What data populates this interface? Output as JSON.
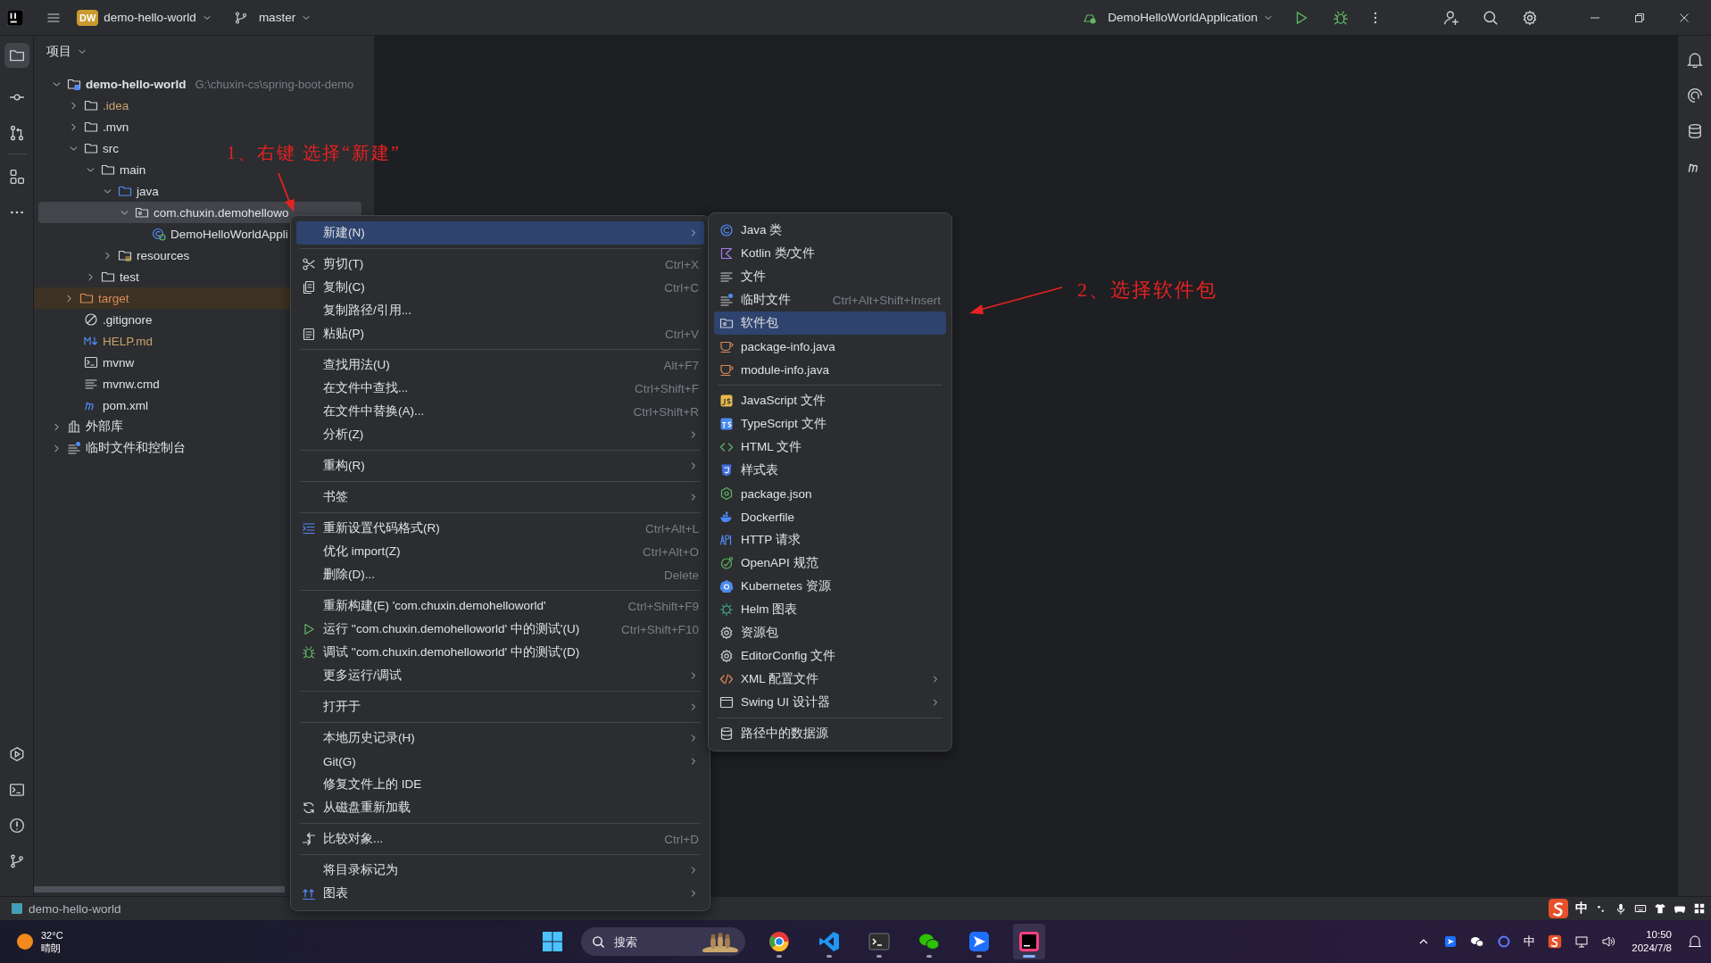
{
  "title_bar": {
    "project_badge": "DW",
    "project": "demo-hello-world",
    "branch": "master",
    "run_configuration": "DemoHelloWorldApplication"
  },
  "project_panel": {
    "title": "项目",
    "tree": [
      {
        "label": "demo-hello-world",
        "path": "G:\\chuxin-cs\\spring-boot-demo",
        "kind": "module",
        "expanded": true,
        "selected": false,
        "ignored": false,
        "children": [
          {
            "label": ".idea",
            "kind": "folder",
            "expanded": false,
            "selected": false,
            "ignored": true
          },
          {
            "label": ".mvn",
            "kind": "folder",
            "expanded": false,
            "selected": false,
            "ignored": false
          },
          {
            "label": "src",
            "kind": "folder",
            "expanded": true,
            "selected": false,
            "ignored": false,
            "children": [
              {
                "label": "main",
                "kind": "folder",
                "expanded": true,
                "selected": false,
                "ignored": false,
                "children": [
                  {
                    "label": "java",
                    "kind": "source-folder",
                    "expanded": true,
                    "selected": false,
                    "ignored": false,
                    "children": [
                      {
                        "label": "com.chuxin.demohellowo",
                        "kind": "package",
                        "expanded": true,
                        "selected": true,
                        "ignored": false,
                        "children": [
                          {
                            "label": "DemoHelloWorldAppli",
                            "kind": "class",
                            "selected": false,
                            "ignored": false
                          }
                        ]
                      }
                    ]
                  },
                  {
                    "label": "resources",
                    "kind": "resources-folder",
                    "expanded": false,
                    "selected": false,
                    "ignored": false
                  }
                ]
              },
              {
                "label": "test",
                "kind": "folder",
                "expanded": false,
                "selected": false,
                "ignored": false
              }
            ]
          },
          {
            "label": "target",
            "kind": "excluded-folder",
            "expanded": false,
            "selected": false,
            "ignored": false
          },
          {
            "label": ".gitignore",
            "kind": "ignore-file",
            "selected": false,
            "ignored": false
          },
          {
            "label": "HELP.md",
            "kind": "markdown",
            "selected": false,
            "ignored": true
          },
          {
            "label": "mvnw",
            "kind": "script",
            "selected": false,
            "ignored": false
          },
          {
            "label": "mvnw.cmd",
            "kind": "text-file",
            "selected": false,
            "ignored": false
          },
          {
            "label": "pom.xml",
            "kind": "maven",
            "selected": false,
            "ignored": false
          }
        ]
      },
      {
        "label": "外部库",
        "kind": "library",
        "expanded": false,
        "selected": false,
        "ignored": false
      },
      {
        "label": "临时文件和控制台",
        "kind": "scratch",
        "expanded": false,
        "selected": false,
        "ignored": false
      }
    ]
  },
  "context_menu": {
    "groups": [
      [
        {
          "label": "新建(N)",
          "kind": "plain",
          "submenu": true,
          "selected": true
        }
      ],
      [
        {
          "label": "剪切(T)",
          "kind": "cut",
          "shortcut": "Ctrl+X",
          "submenu": false,
          "selected": false
        },
        {
          "label": "复制(C)",
          "kind": "copy",
          "shortcut": "Ctrl+C",
          "submenu": false,
          "selected": false
        },
        {
          "label": "复制路径/引用...",
          "kind": "plain",
          "submenu": false,
          "selected": false
        },
        {
          "label": "粘贴(P)",
          "kind": "paste",
          "shortcut": "Ctrl+V",
          "submenu": false,
          "selected": false
        }
      ],
      [
        {
          "label": "查找用法(U)",
          "kind": "plain",
          "shortcut": "Alt+F7",
          "submenu": false,
          "selected": false
        },
        {
          "label": "在文件中查找...",
          "kind": "plain",
          "shortcut": "Ctrl+Shift+F",
          "submenu": false,
          "selected": false
        },
        {
          "label": "在文件中替换(A)...",
          "kind": "plain",
          "shortcut": "Ctrl+Shift+R",
          "submenu": false,
          "selected": false
        },
        {
          "label": "分析(Z)",
          "kind": "plain",
          "submenu": true,
          "selected": false
        }
      ],
      [
        {
          "label": "重构(R)",
          "kind": "plain",
          "submenu": true,
          "selected": false
        }
      ],
      [
        {
          "label": "书签",
          "kind": "plain",
          "submenu": true,
          "selected": false
        }
      ],
      [
        {
          "label": "重新设置代码格式(R)",
          "kind": "reformat",
          "shortcut": "Ctrl+Alt+L",
          "submenu": false,
          "selected": false
        },
        {
          "label": "优化 import(Z)",
          "kind": "plain",
          "shortcut": "Ctrl+Alt+O",
          "submenu": false,
          "selected": false
        },
        {
          "label": "删除(D)...",
          "kind": "plain",
          "shortcut": "Delete",
          "submenu": false,
          "selected": false
        }
      ],
      [
        {
          "label": "重新构建(E) 'com.chuxin.demohelloworld'",
          "kind": "plain",
          "shortcut": "Ctrl+Shift+F9",
          "submenu": false,
          "selected": false
        },
        {
          "label": "运行 ''com.chuxin.demohelloworld' 中的测试'(U)",
          "kind": "run",
          "shortcut": "Ctrl+Shift+F10",
          "submenu": false,
          "selected": false
        },
        {
          "label": "调试 ''com.chuxin.demohelloworld' 中的测试'(D)",
          "kind": "debug",
          "submenu": false,
          "selected": false
        },
        {
          "label": "更多运行/调试",
          "kind": "plain",
          "submenu": true,
          "selected": false
        }
      ],
      [
        {
          "label": "打开于",
          "kind": "plain",
          "submenu": true,
          "selected": false
        }
      ],
      [
        {
          "label": "本地历史记录(H)",
          "kind": "plain",
          "submenu": true,
          "selected": false
        },
        {
          "label": "Git(G)",
          "kind": "plain",
          "submenu": true,
          "selected": false
        },
        {
          "label": "修复文件上的 IDE",
          "kind": "plain",
          "submenu": false,
          "selected": false
        },
        {
          "label": "从磁盘重新加载",
          "kind": "reload",
          "submenu": false,
          "selected": false
        }
      ],
      [
        {
          "label": "比较对象...",
          "kind": "compare",
          "shortcut": "Ctrl+D",
          "submenu": false,
          "selected": false
        }
      ],
      [
        {
          "label": "将目录标记为",
          "kind": "plain",
          "submenu": true,
          "selected": false
        },
        {
          "label": "图表",
          "kind": "diagram",
          "submenu": true,
          "selected": false
        }
      ]
    ]
  },
  "new_submenu": {
    "groups": [
      [
        {
          "label": "Java 类",
          "kind": "java-class",
          "submenu": false,
          "selected": false
        },
        {
          "label": "Kotlin 类/文件",
          "kind": "kotlin",
          "submenu": false,
          "selected": false
        },
        {
          "label": "文件",
          "kind": "file",
          "submenu": false,
          "selected": false
        },
        {
          "label": "临时文件",
          "kind": "scratch",
          "shortcut": "Ctrl+Alt+Shift+Insert",
          "submenu": false,
          "selected": false
        },
        {
          "label": "软件包",
          "kind": "package",
          "submenu": false,
          "selected": true
        },
        {
          "label": "package-info.java",
          "kind": "java-file",
          "submenu": false,
          "selected": false
        },
        {
          "label": "module-info.java",
          "kind": "java-file",
          "submenu": false,
          "selected": false
        }
      ],
      [
        {
          "label": "JavaScript 文件",
          "kind": "js",
          "submenu": false,
          "selected": false
        },
        {
          "label": "TypeScript 文件",
          "kind": "ts",
          "submenu": false,
          "selected": false
        },
        {
          "label": "HTML 文件",
          "kind": "html",
          "submenu": false,
          "selected": false
        },
        {
          "label": "样式表",
          "kind": "css",
          "submenu": false,
          "selected": false
        },
        {
          "label": "package.json",
          "kind": "node",
          "submenu": false,
          "selected": false
        },
        {
          "label": "Dockerfile",
          "kind": "docker",
          "submenu": false,
          "selected": false
        },
        {
          "label": "HTTP 请求",
          "kind": "http",
          "submenu": false,
          "selected": false
        },
        {
          "label": "OpenAPI 规范",
          "kind": "openapi",
          "submenu": false,
          "selected": false
        },
        {
          "label": "Kubernetes 资源",
          "kind": "kubernetes",
          "submenu": false,
          "selected": false
        },
        {
          "label": "Helm 图表",
          "kind": "helm",
          "submenu": false,
          "selected": false
        },
        {
          "label": "资源包",
          "kind": "gear",
          "submenu": false,
          "selected": false
        },
        {
          "label": "EditorConfig 文件",
          "kind": "gear",
          "submenu": false,
          "selected": false
        },
        {
          "label": "XML 配置文件",
          "kind": "xml",
          "submenu": true,
          "selected": false
        },
        {
          "label": "Swing UI 设计器",
          "kind": "window",
          "submenu": true,
          "selected": false
        }
      ],
      [
        {
          "label": "路径中的数据源",
          "kind": "database",
          "submenu": false,
          "selected": false
        }
      ]
    ]
  },
  "annotations": [
    {
      "text": "1、右键 选择“新建”"
    },
    {
      "text": "2、选择软件包"
    }
  ],
  "status_bar": {
    "project": "demo-hello-world",
    "ime_mode": "中"
  },
  "taskbar": {
    "temperature": "32°C",
    "weather": "晴朗",
    "search": {
      "placeholder": "搜索"
    },
    "ime_mode": "中",
    "time": "10:50",
    "date": "2024/7/8"
  }
}
